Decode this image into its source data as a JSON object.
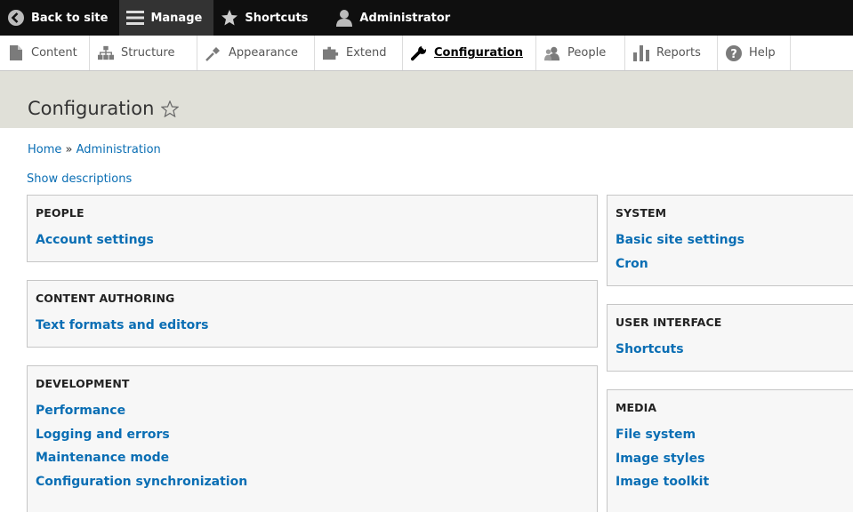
{
  "toolbar": {
    "back": "Back to site",
    "manage": "Manage",
    "shortcuts": "Shortcuts",
    "user": "Administrator"
  },
  "tray": {
    "items": [
      "Content",
      "Structure",
      "Appearance",
      "Extend",
      "Configuration",
      "People",
      "Reports",
      "Help"
    ]
  },
  "page": {
    "title": "Configuration"
  },
  "breadcrumb": {
    "home": "Home",
    "separator": "»",
    "admin": "Administration"
  },
  "show_descriptions": "Show descriptions",
  "panels": {
    "people": {
      "title": "PEOPLE",
      "links": [
        "Account settings"
      ]
    },
    "content_authoring": {
      "title": "CONTENT AUTHORING",
      "links": [
        "Text formats and editors"
      ]
    },
    "development": {
      "title": "DEVELOPMENT",
      "links": [
        "Performance",
        "Logging and errors",
        "Maintenance mode",
        "Configuration synchronization"
      ]
    },
    "system": {
      "title": "SYSTEM",
      "links": [
        "Basic site settings",
        "Cron"
      ]
    },
    "user_interface": {
      "title": "USER INTERFACE",
      "links": [
        "Shortcuts"
      ]
    },
    "media": {
      "title": "MEDIA",
      "links": [
        "File system",
        "Image styles",
        "Image toolkit"
      ]
    }
  },
  "colors": {
    "toolbar_bg": "#0f0f0f",
    "link": "#0a6eb4",
    "header_bg": "#e0e0d8",
    "panel_bg": "#f7f7f7"
  }
}
